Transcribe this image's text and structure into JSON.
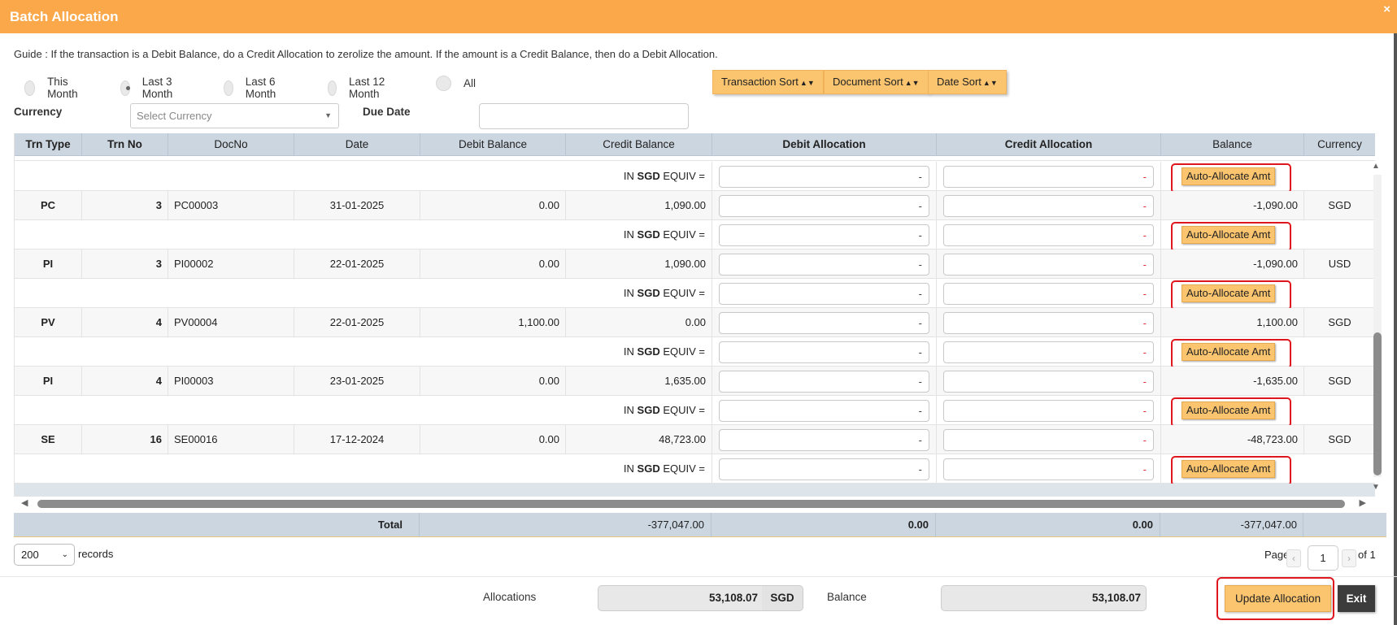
{
  "dialog": {
    "title": "Batch Allocation",
    "close": "×"
  },
  "guide": "Guide : If the transaction is a Debit Balance, do a Credit Allocation to zerolize the amount. If the amount is a Credit Balance, then do a Debit Allocation.",
  "period_options": [
    {
      "label": "This Month",
      "selected": false
    },
    {
      "label": "Last 3 Month",
      "selected": true
    },
    {
      "label": "Last 6 Month",
      "selected": false
    },
    {
      "label": "Last 12 Month",
      "selected": false
    },
    {
      "label": "All",
      "selected": false
    }
  ],
  "sort_buttons": {
    "transaction": "Transaction Sort",
    "document": "Document Sort",
    "date": "Date Sort"
  },
  "filters": {
    "currency_label": "Currency",
    "currency_placeholder": "Select Currency",
    "due_date_label": "Due Date",
    "due_date_value": ""
  },
  "columns": [
    "Trn Type",
    "Trn No",
    "DocNo",
    "Date",
    "Debit Balance",
    "Credit Balance",
    "Debit Allocation",
    "Credit Allocation",
    "Balance",
    "Currency"
  ],
  "equiv": {
    "prefix": "IN",
    "currency": "SGD",
    "suffix": "EQUIV ="
  },
  "alloc_placeholder": "-",
  "auto_allocate_label": "Auto-Allocate Amt",
  "rows": [
    {
      "trn_type": "PC",
      "trn_no": "3",
      "doc_no": "PC00003",
      "date": "31-01-2025",
      "debit_balance": "0.00",
      "credit_balance": "1,090.00",
      "debit_alloc": "-",
      "credit_alloc": "-",
      "balance": "-1,090.00",
      "currency": "SGD"
    },
    {
      "trn_type": "PI",
      "trn_no": "3",
      "doc_no": "PI00002",
      "date": "22-01-2025",
      "debit_balance": "0.00",
      "credit_balance": "1,090.00",
      "debit_alloc": "-",
      "credit_alloc": "-",
      "balance": "-1,090.00",
      "currency": "USD"
    },
    {
      "trn_type": "PV",
      "trn_no": "4",
      "doc_no": "PV00004",
      "date": "22-01-2025",
      "debit_balance": "1,100.00",
      "credit_balance": "0.00",
      "debit_alloc": "-",
      "credit_alloc": "-",
      "balance": "1,100.00",
      "currency": "SGD"
    },
    {
      "trn_type": "PI",
      "trn_no": "4",
      "doc_no": "PI00003",
      "date": "23-01-2025",
      "debit_balance": "0.00",
      "credit_balance": "1,635.00",
      "debit_alloc": "-",
      "credit_alloc": "-",
      "balance": "-1,635.00",
      "currency": "SGD"
    },
    {
      "trn_type": "SE",
      "trn_no": "16",
      "doc_no": "SE00016",
      "date": "17-12-2024",
      "debit_balance": "0.00",
      "credit_balance": "48,723.00",
      "debit_alloc": "-",
      "credit_alloc": "-",
      "balance": "-48,723.00",
      "currency": "SGD"
    }
  ],
  "totals": {
    "label": "Total",
    "credit_balance": "-377,047.00",
    "debit_alloc": "0.00",
    "credit_alloc": "0.00",
    "balance": "-377,047.00"
  },
  "pagination": {
    "page_size": "200",
    "records_label": "records",
    "page_label": "Page",
    "page": "1",
    "of_label": "of 1",
    "prev": "‹",
    "next": "›"
  },
  "footer": {
    "allocations_label": "Allocations",
    "allocations_value": "53,108.07",
    "allocations_currency": "SGD",
    "balance_label": "Balance",
    "balance_value": "53,108.07",
    "update_label": "Update Allocation",
    "exit_label": "Exit"
  },
  "colors": {
    "accent": "#fba84a",
    "button": "#fbc56f",
    "header": "#ccd6e0",
    "highlight": "#e0161e"
  }
}
